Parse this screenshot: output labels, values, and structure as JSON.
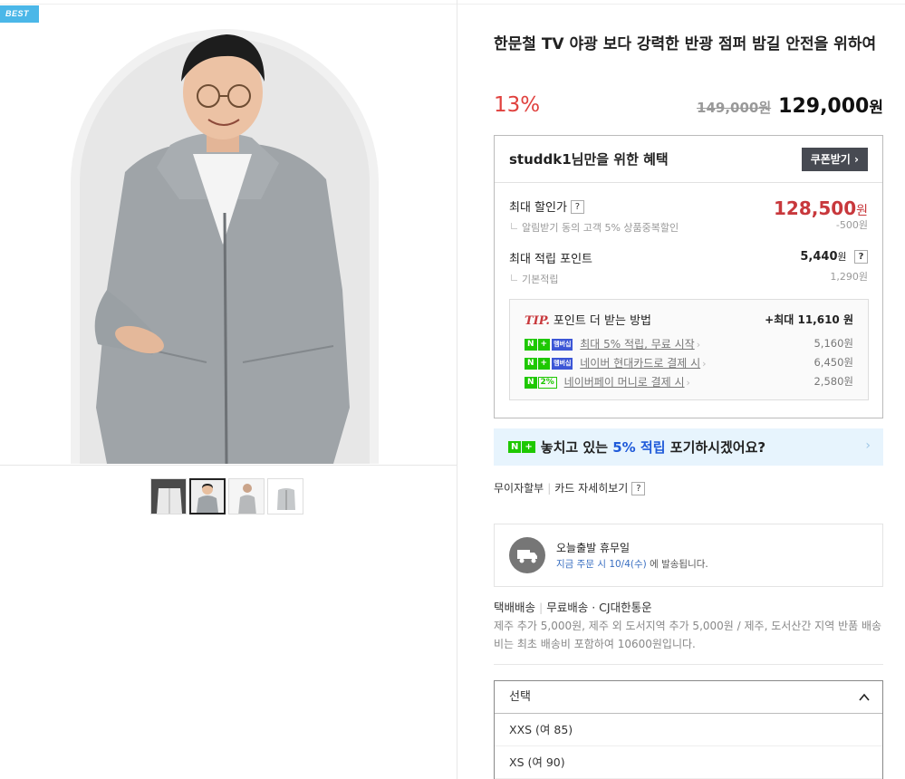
{
  "badge": {
    "best": "BEST"
  },
  "product": {
    "title": "한문철 TV 야광 보다 강력한 반광 점퍼 밤길 안전을 위하여",
    "discount": "13%",
    "original_price": "149,000원",
    "sale_price": "129,000",
    "sale_unit": "원"
  },
  "benefit": {
    "heading": "studdk1님만을 위한 혜택",
    "coupon_button": "쿠폰받기",
    "coupon_chevron": "›",
    "max_discount_label": "최대 할인가",
    "max_discount_value": "128,500",
    "max_discount_unit": "원",
    "max_discount_sub": "알림받기 동의 고객 5% 상품중복할인",
    "max_discount_sub_value": "-500원",
    "max_point_label": "최대 적립 포인트",
    "max_point_value": "5,440",
    "max_point_unit": "원",
    "base_point_label": "기본적립",
    "base_point_value": "1,290원",
    "help_mark": "?"
  },
  "tip": {
    "tip_label": "TIP.",
    "title": "포인트 더 받는 방법",
    "total": "+최대 11,610 원",
    "rows": [
      {
        "badge_n": "N",
        "badge_plus": "+",
        "badge_tag": "멤버십",
        "text": "최대 5% 적립, 무료 시작",
        "value": "5,160원"
      },
      {
        "badge_n": "N",
        "badge_plus": "+",
        "badge_tag": "멤버십",
        "text": "네이버 현대카드로 결제 시",
        "value": "6,450원"
      },
      {
        "badge_n": "N",
        "badge_plus": "2%",
        "badge_tag": "",
        "text": "네이버페이 머니로 결제 시",
        "value": "2,580원"
      }
    ]
  },
  "banner": {
    "badge_n": "N",
    "badge_plus": "+",
    "text_pre": "놓치고 있는",
    "text_highlight": "5% 적립",
    "text_post": "포기하시겠어요?",
    "arrow": "›"
  },
  "cardinfo": {
    "installment": "무이자할부",
    "card_detail": "카드 자세히보기",
    "help_mark": "?"
  },
  "shipping": {
    "title": "오늘출발 휴무일",
    "sub_highlight": "지금 주문 시 10/4(수)",
    "sub_rest": "에 발송됩니다."
  },
  "delivery": {
    "type": "택배배송",
    "fee": "무료배송 · CJ대한통운",
    "note": "제주 추가 5,000원, 제주 외 도서지역 추가 5,000원 / 제주, 도서산간 지역 반품 배송비는 최초 배송비 포함하여 10600원입니다."
  },
  "select": {
    "placeholder": "선택",
    "options": [
      "XXS (여 85)",
      "XS (여 90)"
    ]
  },
  "colors": {
    "accent_red": "#c8383c",
    "naver_green": "#1ec800",
    "badge_blue": "#4bb7e8"
  }
}
